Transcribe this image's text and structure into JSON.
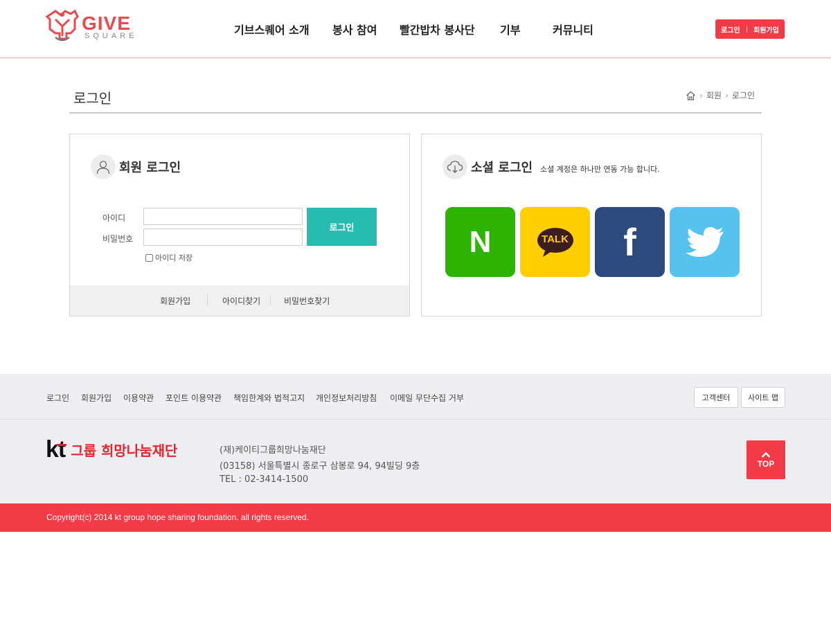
{
  "header": {
    "logo": {
      "main": "GIVE",
      "sub": "SQUARE"
    },
    "nav": [
      "기브스퀘어 소개",
      "봉사 참여",
      "빨간밥차 봉사단",
      "기부",
      "커뮤니티"
    ],
    "auth": {
      "login": "로그인",
      "separator": "|",
      "signup": "회원가입"
    }
  },
  "page": {
    "title": "로그인",
    "breadcrumb": [
      "회원",
      "로그인"
    ]
  },
  "member_login": {
    "title": "회원 로그인",
    "id_label": "아이디",
    "password_label": "비밀번호",
    "id_value": "",
    "password_value": "",
    "login_button": "로그인",
    "remember_label": "아이디 저장",
    "links": [
      "회원가입",
      "아이디찾기",
      "비밀번호찾기"
    ]
  },
  "social_login": {
    "title": "소셜 로그인",
    "subtitle": "소셜 계정은 하나만 연동 가능 합니다.",
    "providers": [
      {
        "name": "naver",
        "label": "N",
        "color": "#2db400"
      },
      {
        "name": "kakao",
        "label": "TALK",
        "color": "#ffcd00"
      },
      {
        "name": "facebook",
        "label": "f",
        "color": "#2d4a7e"
      },
      {
        "name": "twitter",
        "color": "#55c2ef"
      }
    ]
  },
  "footer": {
    "links": [
      "로그인",
      "회원가입",
      "이용약관",
      "포인트 이용약관",
      "책임한계와 법적고지",
      "개인정보처리방침",
      "이메일 무단수집 거부"
    ],
    "buttons": [
      "고객센터",
      "사이트 맵"
    ],
    "org_logo": {
      "mark": "kt",
      "name": "그룹 희망나눔재단"
    },
    "address": [
      "(재)케이티그룹희망나눔재단",
      "(03158) 서울특별시 종로구 삼봉로 94, 94빌딩 9층",
      "TEL : 02-3414-1500"
    ],
    "top_label": "TOP",
    "copyright": "Copyright(c) 2014 kt group hope sharing foundation. all rights reserved."
  },
  "colors": {
    "accent": "#f23b46",
    "teal": "#28bbb1"
  }
}
